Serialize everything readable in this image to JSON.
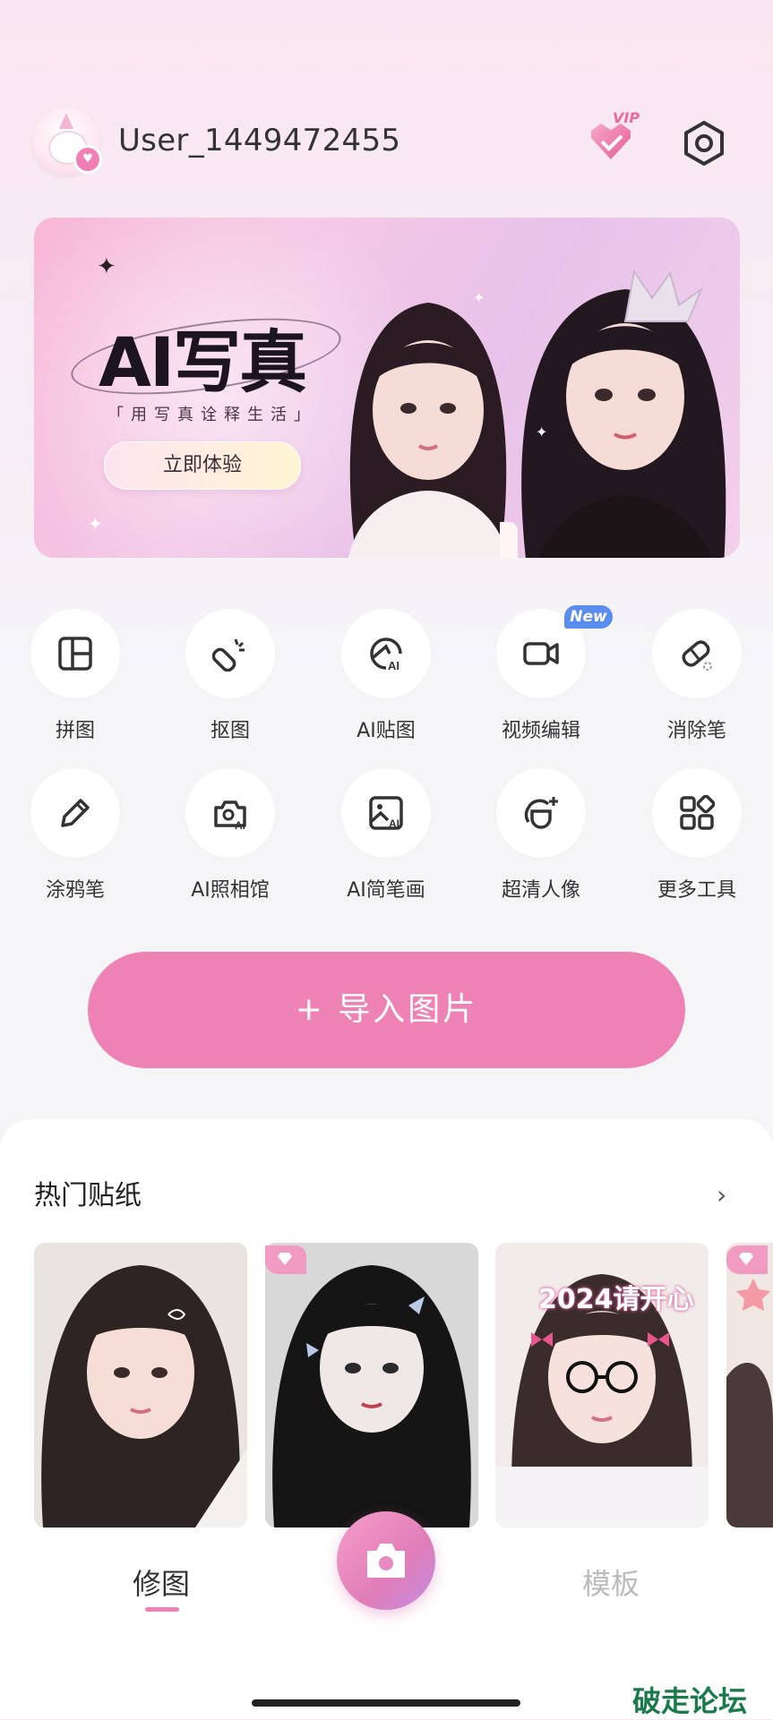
{
  "header": {
    "username": "User_1449472455",
    "vip_label": "VIP"
  },
  "banner": {
    "title": "AI写真",
    "subtitle": "「用写真诠释生活」",
    "cta": "立即体验"
  },
  "tools": [
    {
      "label": "拼图",
      "icon": "collage-icon"
    },
    {
      "label": "抠图",
      "icon": "cutout-icon"
    },
    {
      "label": "AI贴图",
      "icon": "ai-sticker-icon"
    },
    {
      "label": "视频编辑",
      "icon": "video-icon"
    },
    {
      "label": "消除笔",
      "icon": "eraser-icon"
    },
    {
      "label": "涂鸦笔",
      "icon": "pencil-icon"
    },
    {
      "label": "AI照相馆",
      "icon": "ai-camera-icon"
    },
    {
      "label": "AI简笔画",
      "icon": "ai-sketch-icon"
    },
    {
      "label": "超清人像",
      "icon": "hd-portrait-icon"
    },
    {
      "label": "更多工具",
      "icon": "more-tools-icon"
    }
  ],
  "new_badge": "New",
  "import_button": "+ 导入图片",
  "stickers": {
    "title": "热门贴纸",
    "cards": [
      {
        "vip": false
      },
      {
        "vip": true
      },
      {
        "vip": false,
        "caption": "2024请开心"
      },
      {
        "vip": true
      }
    ]
  },
  "nav": {
    "edit": "修图",
    "template": "模板"
  },
  "watermark": "破走论坛",
  "colors": {
    "accent": "#ee82b4",
    "new_badge": "#5b8def"
  }
}
